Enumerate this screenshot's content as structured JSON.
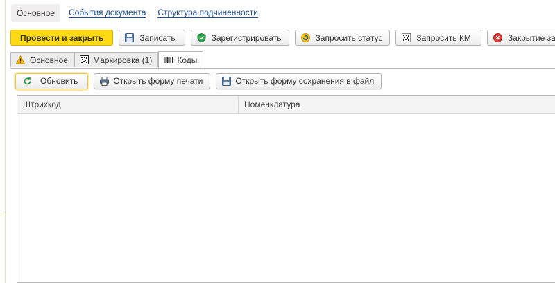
{
  "topnav": {
    "active": "Основное",
    "links": [
      "События документа",
      "Структура подчиненности"
    ]
  },
  "toolbar": {
    "post_close": "Провести и закрыть",
    "save": "Записать",
    "register": "Зарегистрировать",
    "request_status": "Запросить статус",
    "request_km": "Запросить КМ",
    "close_order": "Закрытие заказа"
  },
  "tabs": [
    {
      "label": "Основное",
      "icon": "warning-icon"
    },
    {
      "label": "Маркировка (1)",
      "icon": "datamatrix-icon"
    },
    {
      "label": "Коды",
      "icon": "barcode-icon"
    }
  ],
  "subbar": {
    "refresh": "Обновить",
    "print_form": "Открыть форму печати",
    "save_form": "Открыть форму сохранения в файл"
  },
  "table": {
    "columns": [
      "Штрихкод",
      "Номенклатура"
    ],
    "rows": []
  },
  "colors": {
    "primary_button": "#ffd914",
    "link": "#1e4c8c",
    "focus": "#e6c75d"
  }
}
